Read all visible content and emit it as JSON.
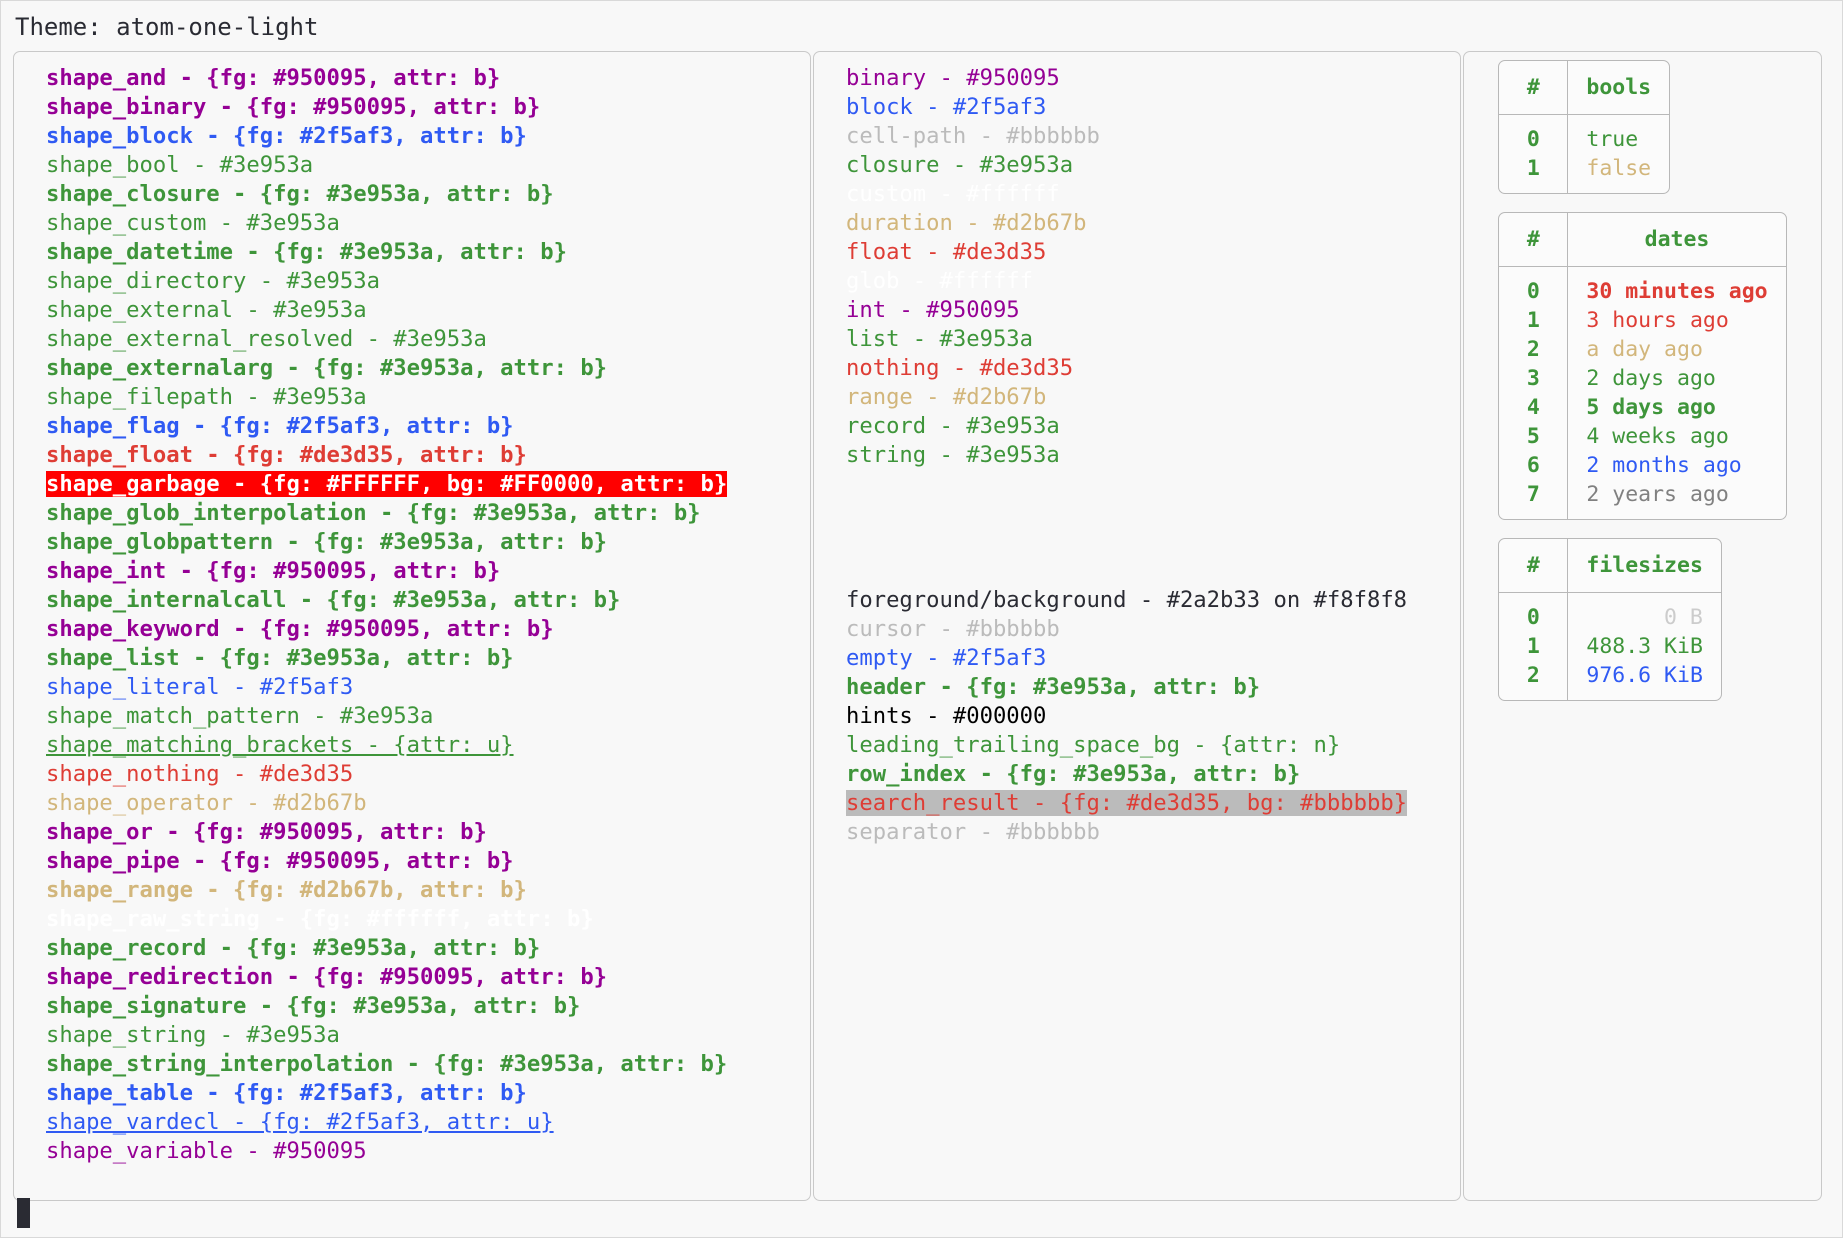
{
  "header": {
    "theme_label": "Theme: atom-one-light"
  },
  "colors": {
    "magenta": "#950095",
    "blue": "#2f5af3",
    "green": "#3e953a",
    "red": "#de3d35",
    "tan": "#d2b67b",
    "white": "#ffffff",
    "grey": "#bbbbbb",
    "black": "#000000",
    "foreground": "#2a2b33",
    "background": "#f8f8f8",
    "garbage_bg": "#FF0000",
    "garbage_fg": "#FFFFFF"
  },
  "shapes": [
    {
      "text": "shape_and - {fg: #950095, attr: b}",
      "fg": "#950095",
      "bold": true
    },
    {
      "text": "shape_binary - {fg: #950095, attr: b}",
      "fg": "#950095",
      "bold": true
    },
    {
      "text": "shape_block - {fg: #2f5af3, attr: b}",
      "fg": "#2f5af3",
      "bold": true
    },
    {
      "text": "shape_bool - #3e953a",
      "fg": "#3e953a",
      "bold": false
    },
    {
      "text": "shape_closure - {fg: #3e953a, attr: b}",
      "fg": "#3e953a",
      "bold": true
    },
    {
      "text": "shape_custom - #3e953a",
      "fg": "#3e953a",
      "bold": false
    },
    {
      "text": "shape_datetime - {fg: #3e953a, attr: b}",
      "fg": "#3e953a",
      "bold": true
    },
    {
      "text": "shape_directory - #3e953a",
      "fg": "#3e953a",
      "bold": false
    },
    {
      "text": "shape_external - #3e953a",
      "fg": "#3e953a",
      "bold": false
    },
    {
      "text": "shape_external_resolved - #3e953a",
      "fg": "#3e953a",
      "bold": false
    },
    {
      "text": "shape_externalarg - {fg: #3e953a, attr: b}",
      "fg": "#3e953a",
      "bold": true
    },
    {
      "text": "shape_filepath - #3e953a",
      "fg": "#3e953a",
      "bold": false
    },
    {
      "text": "shape_flag - {fg: #2f5af3, attr: b}",
      "fg": "#2f5af3",
      "bold": true
    },
    {
      "text": "shape_float - {fg: #de3d35, attr: b}",
      "fg": "#de3d35",
      "bold": true
    },
    {
      "text": "shape_garbage - {fg: #FFFFFF, bg: #FF0000, attr: b}",
      "fg": "#FFFFFF",
      "bg": "#FF0000",
      "bold": true
    },
    {
      "text": "shape_glob_interpolation - {fg: #3e953a, attr: b}",
      "fg": "#3e953a",
      "bold": true
    },
    {
      "text": "shape_globpattern - {fg: #3e953a, attr: b}",
      "fg": "#3e953a",
      "bold": true
    },
    {
      "text": "shape_int - {fg: #950095, attr: b}",
      "fg": "#950095",
      "bold": true
    },
    {
      "text": "shape_internalcall - {fg: #3e953a, attr: b}",
      "fg": "#3e953a",
      "bold": true
    },
    {
      "text": "shape_keyword - {fg: #950095, attr: b}",
      "fg": "#950095",
      "bold": true
    },
    {
      "text": "shape_list - {fg: #3e953a, attr: b}",
      "fg": "#3e953a",
      "bold": true
    },
    {
      "text": "shape_literal - #2f5af3",
      "fg": "#2f5af3",
      "bold": false
    },
    {
      "text": "shape_match_pattern - #3e953a",
      "fg": "#3e953a",
      "bold": false
    },
    {
      "text": "shape_matching_brackets - {attr: u}",
      "fg": "#3e953a",
      "bold": false,
      "underline": true
    },
    {
      "text": "shape_nothing - #de3d35",
      "fg": "#de3d35",
      "bold": false
    },
    {
      "text": "shape_operator - #d2b67b",
      "fg": "#d2b67b",
      "bold": false
    },
    {
      "text": "shape_or - {fg: #950095, attr: b}",
      "fg": "#950095",
      "bold": true
    },
    {
      "text": "shape_pipe - {fg: #950095, attr: b}",
      "fg": "#950095",
      "bold": true
    },
    {
      "text": "shape_range - {fg: #d2b67b, attr: b}",
      "fg": "#d2b67b",
      "bold": true
    },
    {
      "text": "shape_raw_string - {fg: #ffffff, attr: b}",
      "fg": "#ffffff",
      "bold": true
    },
    {
      "text": "shape_record - {fg: #3e953a, attr: b}",
      "fg": "#3e953a",
      "bold": true
    },
    {
      "text": "shape_redirection - {fg: #950095, attr: b}",
      "fg": "#950095",
      "bold": true
    },
    {
      "text": "shape_signature - {fg: #3e953a, attr: b}",
      "fg": "#3e953a",
      "bold": true
    },
    {
      "text": "shape_string - #3e953a",
      "fg": "#3e953a",
      "bold": false
    },
    {
      "text": "shape_string_interpolation - {fg: #3e953a, attr: b}",
      "fg": "#3e953a",
      "bold": true
    },
    {
      "text": "shape_table - {fg: #2f5af3, attr: b}",
      "fg": "#2f5af3",
      "bold": true
    },
    {
      "text": "shape_vardecl - {fg: #2f5af3, attr: u}",
      "fg": "#2f5af3",
      "bold": false,
      "underline": true
    },
    {
      "text": "shape_variable - #950095",
      "fg": "#950095",
      "bold": false
    }
  ],
  "primitives": [
    {
      "text": "binary - #950095",
      "fg": "#950095",
      "bold": false
    },
    {
      "text": "block - #2f5af3",
      "fg": "#2f5af3",
      "bold": false
    },
    {
      "text": "cell-path - #bbbbbb",
      "fg": "#bbbbbb",
      "bold": false
    },
    {
      "text": "closure - #3e953a",
      "fg": "#3e953a",
      "bold": false
    },
    {
      "text": "custom - #ffffff",
      "fg": "#ffffff",
      "bold": false
    },
    {
      "text": "duration - #d2b67b",
      "fg": "#d2b67b",
      "bold": false
    },
    {
      "text": "float - #de3d35",
      "fg": "#de3d35",
      "bold": false
    },
    {
      "text": "glob - #ffffff",
      "fg": "#ffffff",
      "bold": false
    },
    {
      "text": "int - #950095",
      "fg": "#950095",
      "bold": false
    },
    {
      "text": "list - #3e953a",
      "fg": "#3e953a",
      "bold": false
    },
    {
      "text": "nothing - #de3d35",
      "fg": "#de3d35",
      "bold": false
    },
    {
      "text": "range - #d2b67b",
      "fg": "#d2b67b",
      "bold": false
    },
    {
      "text": "record - #3e953a",
      "fg": "#3e953a",
      "bold": false
    },
    {
      "text": "string - #3e953a",
      "fg": "#3e953a",
      "bold": false
    }
  ],
  "ui_elements": [
    {
      "text": "foreground/background - #2a2b33 on #f8f8f8",
      "fg": "#2a2b33",
      "bold": false
    },
    {
      "text": "cursor - #bbbbbb",
      "fg": "#bbbbbb",
      "bold": false
    },
    {
      "text": "empty - #2f5af3",
      "fg": "#2f5af3",
      "bold": false
    },
    {
      "text": "header - {fg: #3e953a, attr: b}",
      "fg": "#3e953a",
      "bold": true
    },
    {
      "text": "hints - #000000",
      "fg": "#000000",
      "bold": false
    },
    {
      "text": "leading_trailing_space_bg - {attr: n}",
      "fg": "#3e953a",
      "bold": false
    },
    {
      "text": "row_index - {fg: #3e953a, attr: b}",
      "fg": "#3e953a",
      "bold": true
    },
    {
      "text": "search_result - {fg: #de3d35, bg: #bbbbbb}",
      "fg": "#de3d35",
      "bg": "#bbbbbb",
      "bold": false
    },
    {
      "text": "separator - #bbbbbb",
      "fg": "#bbbbbb",
      "bold": false
    }
  ],
  "tables": [
    {
      "name": "bools-table",
      "index_header": "#",
      "value_header": "bools",
      "value_align": "left",
      "rows": [
        {
          "index": "0",
          "value": "true",
          "fg": "#3e953a",
          "bold": false
        },
        {
          "index": "1",
          "value": "false",
          "fg": "#d2b67b",
          "bold": false
        }
      ]
    },
    {
      "name": "dates-table",
      "index_header": "#",
      "value_header": "dates",
      "value_align": "left",
      "rows": [
        {
          "index": "0",
          "value": "30 minutes ago",
          "fg": "#de3d35",
          "bold": true
        },
        {
          "index": "1",
          "value": "3 hours ago",
          "fg": "#de3d35",
          "bold": false
        },
        {
          "index": "2",
          "value": "a day ago",
          "fg": "#d2b67b",
          "bold": false
        },
        {
          "index": "3",
          "value": "2 days ago",
          "fg": "#3e953a",
          "bold": false
        },
        {
          "index": "4",
          "value": "5 days ago",
          "fg": "#3e953a",
          "bold": true
        },
        {
          "index": "5",
          "value": "4 weeks ago",
          "fg": "#3e953a",
          "bold": false
        },
        {
          "index": "6",
          "value": "2 months ago",
          "fg": "#2f5af3",
          "bold": false
        },
        {
          "index": "7",
          "value": "2 years ago",
          "fg": "#808080",
          "bold": false
        }
      ]
    },
    {
      "name": "filesizes-table",
      "index_header": "#",
      "value_header": "filesizes",
      "value_align": "right",
      "rows": [
        {
          "index": "0",
          "value": "0 B",
          "fg": "#cccccc",
          "bold": false
        },
        {
          "index": "1",
          "value": "488.3 KiB",
          "fg": "#3e953a",
          "bold": false
        },
        {
          "index": "2",
          "value": "976.6 KiB",
          "fg": "#2f5af3",
          "bold": false
        }
      ]
    }
  ]
}
